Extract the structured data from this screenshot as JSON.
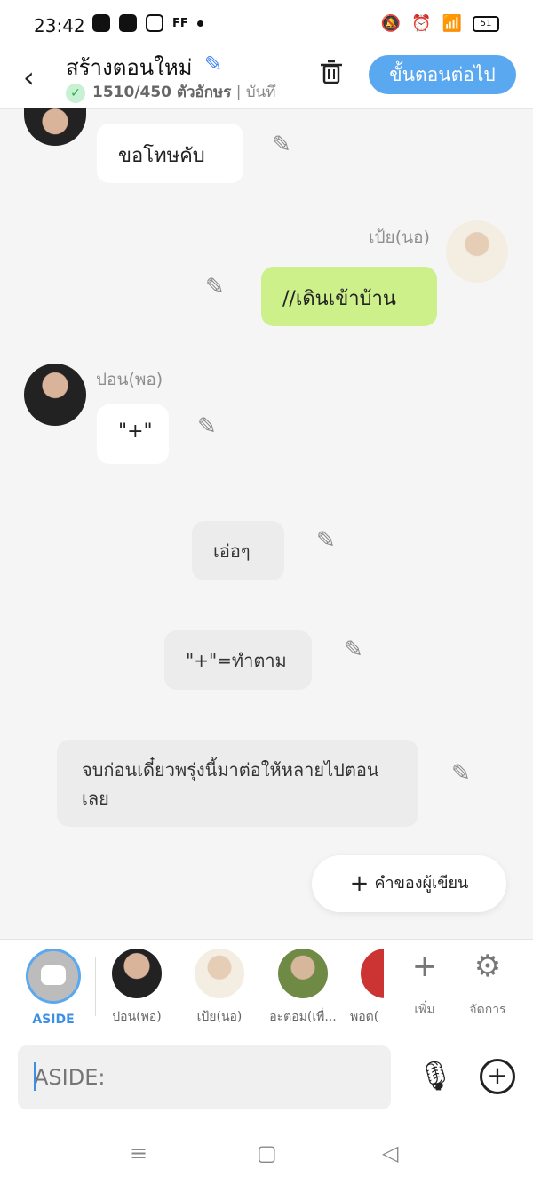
{
  "status_bar": {
    "time": "23:42",
    "left_icons": [
      "snapchat-icon",
      "youtube-icon",
      "instagram-icon",
      "ff-icon"
    ],
    "ff_label": "FF",
    "right_icons": [
      "mute-icon",
      "alarm-icon",
      "wifi-icon",
      "signal-icon"
    ],
    "battery": "51"
  },
  "header": {
    "title": "สร้างตอนใหม่",
    "subtitle_count": "1510/450 ตัวอักษร",
    "subtitle_more": " | บันทึ",
    "next_button": "ขั้นตอนต่อไป",
    "accent": "#5aa9f0"
  },
  "chat": {
    "msg1": "ขอโทษคับ",
    "msg2_name": "เป้ย(นอ)",
    "msg2": "//เดินเข้าบ้าน",
    "msg3_name": "ปอน(พอ)",
    "msg3": "\"+\"",
    "aside1": "เอ่อๆ",
    "aside2": "\"+\"=ทำตาม",
    "aside3": "จบก่อนเดี๋ยวพรุ่งนี้มาต่อให้หลายไปตอนเลย",
    "author_button": "คำของผู้เขียน"
  },
  "characters": {
    "aside": "ASIDE",
    "c1": "ปอน(พอ)",
    "c2": "เป้ย(นอ)",
    "c3": "อะตอม(เพื่...",
    "c4": "พอต(",
    "add": "เพิ่ม",
    "manage": "จัดการ"
  },
  "input": {
    "placeholder": "ASIDE:"
  }
}
